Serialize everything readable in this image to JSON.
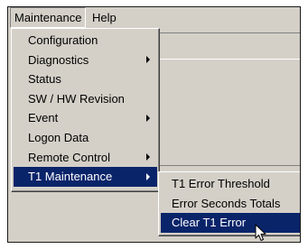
{
  "menubar": {
    "maintenance_label": "Maintenance",
    "help_label": "Help"
  },
  "maintenance_menu": {
    "items": [
      {
        "label": "Configuration",
        "has_submenu": false
      },
      {
        "label": "Diagnostics",
        "has_submenu": true
      },
      {
        "label": "Status",
        "has_submenu": false
      },
      {
        "label": "SW / HW Revision",
        "has_submenu": false
      },
      {
        "label": "Event",
        "has_submenu": true
      },
      {
        "label": "Logon Data",
        "has_submenu": false
      },
      {
        "label": "Remote Control",
        "has_submenu": true
      },
      {
        "label": "T1 Maintenance",
        "has_submenu": true
      }
    ],
    "highlighted": "T1 Maintenance"
  },
  "t1_submenu": {
    "items": [
      {
        "label": "T1 Error Threshold"
      },
      {
        "label": "Error Seconds Totals"
      },
      {
        "label": "Clear T1 Error"
      }
    ],
    "highlighted": "Clear T1 Error"
  },
  "colors": {
    "menu_face": "#d4d0c8",
    "highlight": "#0a246a",
    "highlight_text": "#ffffff"
  },
  "icons": {
    "submenu_indicator": "right-triangle-arrow",
    "pointer": "mouse-pointer-arrow"
  }
}
